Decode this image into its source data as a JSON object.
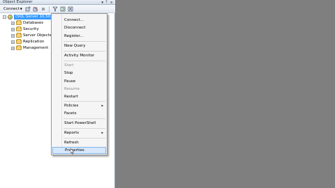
{
  "explorer": {
    "title": "Object Explorer",
    "title_controls": [
      "▾",
      "ᛘ",
      "×"
    ],
    "toolbar": {
      "connect_label": "Connect",
      "icons": [
        "connect-object-explorer-icon",
        "disconnect-icon",
        "stop-icon",
        "filter-icon",
        "refresh-icon",
        "summary-icon"
      ]
    },
    "root": {
      "expander": "−",
      "label": "(SQL Server 10.50..."
    },
    "folders": [
      {
        "expander": "+",
        "label": "Databases"
      },
      {
        "expander": "+",
        "label": "Security"
      },
      {
        "expander": "+",
        "label": "Server Objects"
      },
      {
        "expander": "+",
        "label": "Replication"
      },
      {
        "expander": "+",
        "label": "Management"
      }
    ]
  },
  "context_menu": {
    "items": [
      {
        "label": "Connect...",
        "enabled": true
      },
      {
        "label": "Disconnect",
        "enabled": true
      },
      {
        "label": "Register...",
        "enabled": true
      },
      {
        "label": "New Query",
        "enabled": true
      },
      {
        "label": "Activity Monitor",
        "enabled": true
      },
      {
        "label": "Start",
        "enabled": false
      },
      {
        "label": "Stop",
        "enabled": true
      },
      {
        "label": "Pause",
        "enabled": true
      },
      {
        "label": "Resume",
        "enabled": false
      },
      {
        "label": "Restart",
        "enabled": true
      },
      {
        "label": "Policies",
        "enabled": true,
        "submenu": true
      },
      {
        "label": "Facets",
        "enabled": true
      },
      {
        "label": "Start PowerShell",
        "enabled": true
      },
      {
        "label": "Reports",
        "enabled": true,
        "submenu": true
      },
      {
        "label": "Refresh",
        "enabled": true
      },
      {
        "label": "Properties",
        "enabled": true,
        "highlighted": true
      }
    ],
    "submenu_arrow": "▸"
  },
  "colors": {
    "selection": "#3399ff",
    "menu_bg": "#f5f5f5",
    "hover_bg": "#d7e8fb",
    "workspace_bg": "#7f7f7f"
  }
}
